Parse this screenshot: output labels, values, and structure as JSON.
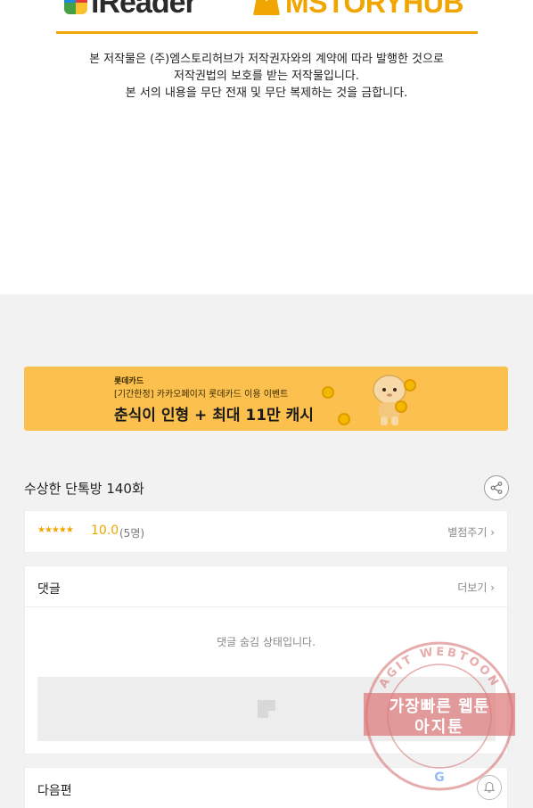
{
  "logos": {
    "ireader": "iReader",
    "mstory": "MSTORYHUB"
  },
  "copyright": {
    "line1": "본 저작물은 (주)엠스토리허브가 저작권자와의 계약에 따라 발행한 것으로",
    "line2": "저작권법의 보호를 받는 저작물입니다.",
    "line3": "본 서의 내용을 무단 전재 및 무단 복제하는 것을 금합니다."
  },
  "banner": {
    "brand": "롯데카드",
    "sub": "[기간한정] 카카오페이지 롯데카드 이용 이벤트",
    "headline": "춘식이 인형 + 최대 11만 캐시"
  },
  "episode": {
    "title": "수상한 단톡방 140화",
    "share_icon": "share-icon"
  },
  "rating": {
    "stars": "★★★★★",
    "value": "10.0",
    "count": "(5명)",
    "action": "별점주기 ›"
  },
  "comments": {
    "title": "댓글",
    "more": "더보기 ›",
    "hidden_notice": "댓글 숨김 상태입니다."
  },
  "next": {
    "title": "다음편",
    "bell_icon": "bell-icon"
  },
  "watermark": {
    "ring_text": "AGIT WEBTOON",
    "line1": "가장빠른 웹툰",
    "line2": "아지툰"
  },
  "colors": {
    "accent": "#f0a500",
    "banner_bg": "#fbc04d",
    "gray_bg": "#f2f2f2",
    "stamp": "#d46a6a"
  }
}
